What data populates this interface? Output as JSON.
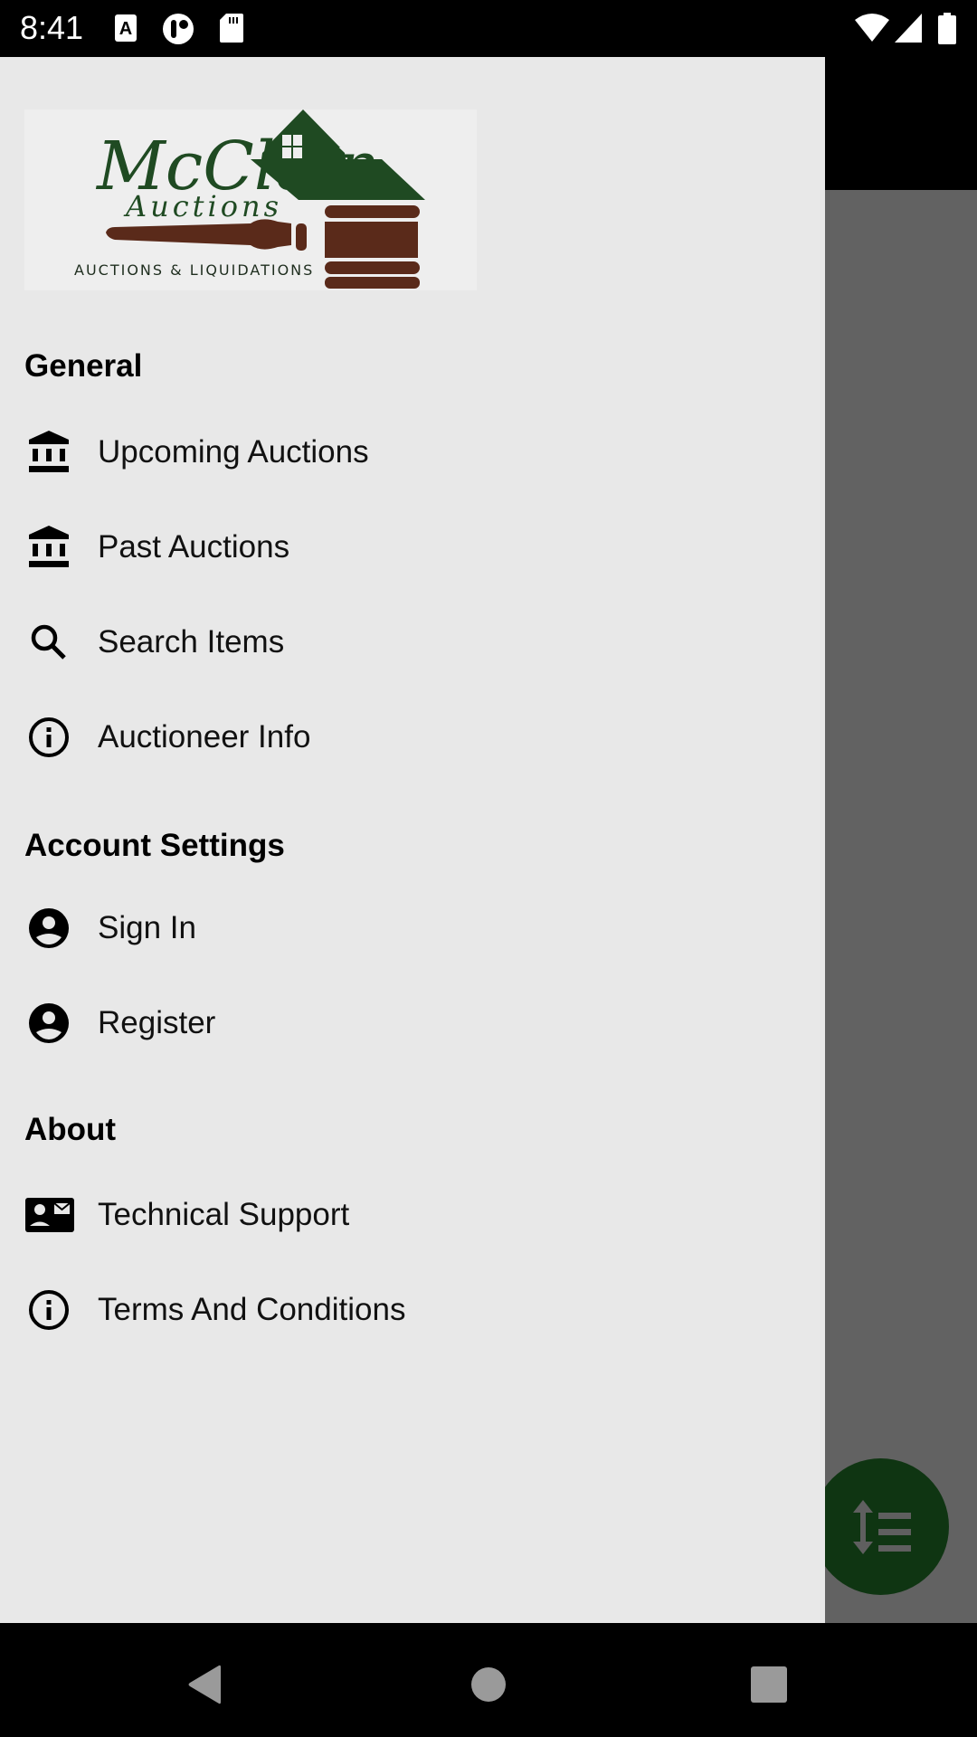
{
  "status_bar": {
    "time": "8:41",
    "left_icons": [
      "font-a-icon",
      "vpn-key-icon",
      "sd-card-icon"
    ],
    "right_icons": [
      "wifi-icon",
      "cell-signal-icon",
      "battery-icon"
    ]
  },
  "drawer": {
    "logo": {
      "title_line1": "McClain",
      "title_line2": "Auctions",
      "tagline": "AUCTIONS & LIQUIDATIONS",
      "colors": {
        "green": "#1f4a22",
        "brown": "#5a2a1a"
      }
    },
    "sections": [
      {
        "header": "General",
        "items": [
          {
            "label": "Upcoming Auctions",
            "icon": "bank-icon"
          },
          {
            "label": "Past Auctions",
            "icon": "bank-icon"
          },
          {
            "label": "Search Items",
            "icon": "search-icon"
          },
          {
            "label": "Auctioneer Info",
            "icon": "info-icon"
          }
        ]
      },
      {
        "header": "Account Settings",
        "items": [
          {
            "label": "Sign In",
            "icon": "account-circle-icon"
          },
          {
            "label": "Register",
            "icon": "account-circle-icon"
          }
        ]
      },
      {
        "header": "About",
        "items": [
          {
            "label": "Technical Support",
            "icon": "contact-mail-icon"
          },
          {
            "label": "Terms And Conditions",
            "icon": "info-icon"
          }
        ]
      }
    ]
  },
  "fab": {
    "icon": "sort-icon",
    "color": "#0f3512"
  },
  "nav_bar": {
    "buttons": [
      "back",
      "home",
      "recents"
    ]
  }
}
